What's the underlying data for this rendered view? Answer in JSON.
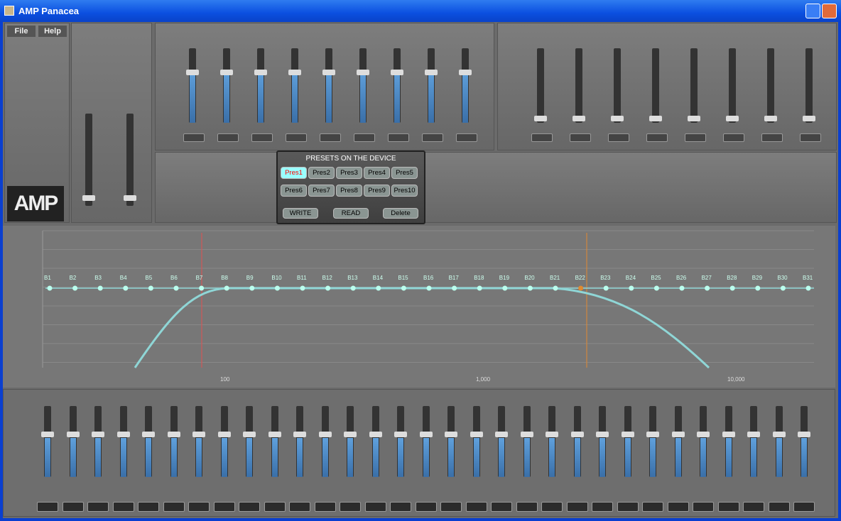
{
  "window": {
    "title": "AMP Panacea"
  },
  "menu": {
    "file": "File",
    "help": "Help"
  },
  "logo": "AMP",
  "presets": {
    "title": "PRESETS ON THE DEVICE",
    "items": [
      "Pres1",
      "Pres2",
      "Pres3",
      "Pres4",
      "Pres5",
      "Pres6",
      "Pres7",
      "Pres8",
      "Pres9",
      "Pres10"
    ],
    "selected": 0,
    "write": "WRITE",
    "read": "READ",
    "delete": "Delete"
  },
  "eq": {
    "bands": [
      "B1",
      "B2",
      "B3",
      "B4",
      "B5",
      "B6",
      "B7",
      "B8",
      "B9",
      "B10",
      "B11",
      "B12",
      "B13",
      "B14",
      "B15",
      "B16",
      "B17",
      "B18",
      "B19",
      "B20",
      "B21",
      "B22",
      "B23",
      "B24",
      "B25",
      "B26",
      "B27",
      "B28",
      "B29",
      "B30",
      "B31"
    ],
    "freq_labels": [
      "100",
      "1,000",
      "10,000"
    ],
    "colors": {
      "curve": "#8fd6d6",
      "hp": "#e05050",
      "lp": "#e08a30"
    }
  }
}
